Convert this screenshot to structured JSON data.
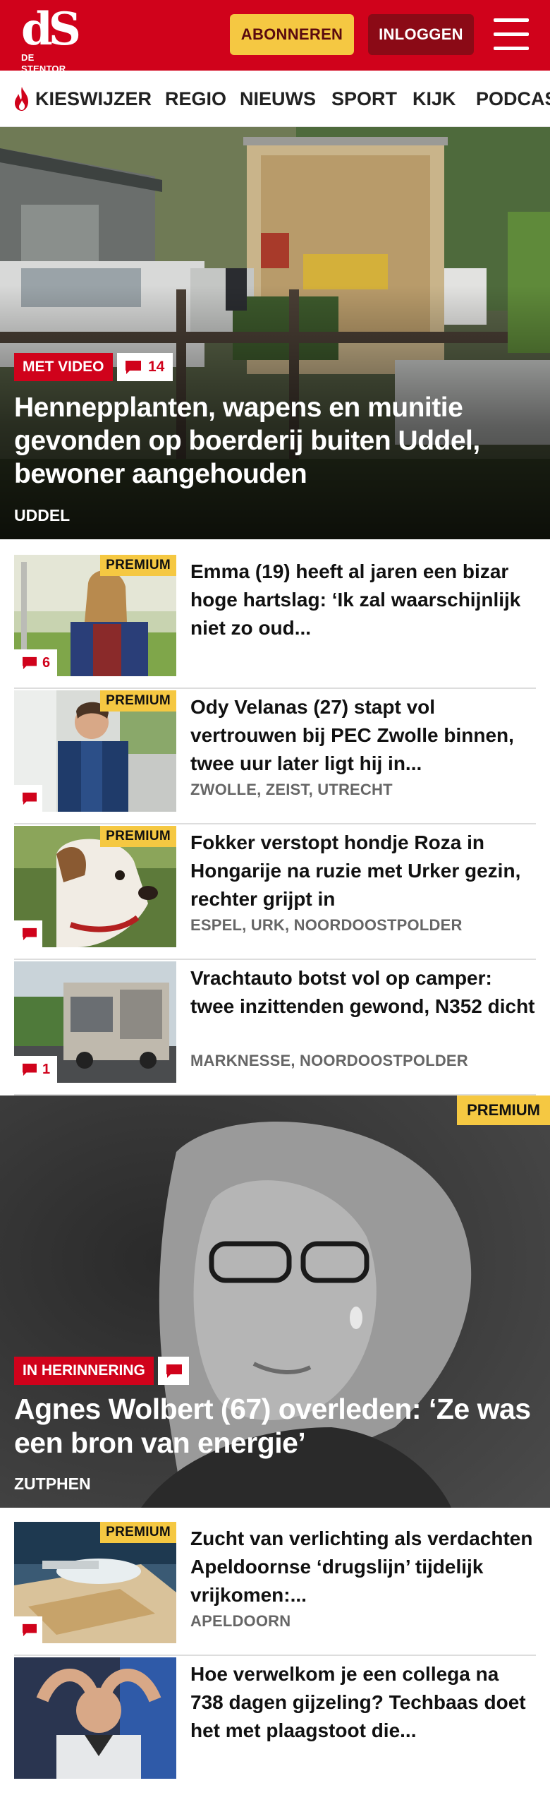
{
  "header": {
    "logo_mark": "dS",
    "logo_name": "DE STENTOR",
    "subscribe_label": "ABONNEREN",
    "login_label": "INLOGGEN",
    "brand_color": "#d0021b",
    "accent_color": "#f5c842"
  },
  "nav": {
    "items": [
      "KIESWIJZER",
      "REGIO",
      "NIEUWS",
      "SPORT",
      "KIJK",
      "PODCASTS"
    ],
    "highlight_icon": "flame-icon"
  },
  "hero": {
    "tag": "MET VIDEO",
    "comments": "14",
    "title": "Hennepplanten, wapens en munitie gevonden op boerderij buiten Uddel, bewoner aangehouden",
    "location": "UDDEL"
  },
  "articles_top": [
    {
      "title": "Emma (19) heeft al jaren een bizar hoge hartslag: ‘Ik zal waarschijnlijk niet zo oud...",
      "location": "",
      "premium": "PREMIUM",
      "comments": "6"
    },
    {
      "title": "Ody Velanas (27) stapt vol vertrouwen bij PEC Zwolle binnen, twee uur later ligt hij in...",
      "location": "ZWOLLE, ZEIST, UTRECHT",
      "premium": "PREMIUM",
      "comments": ""
    },
    {
      "title": "Fokker verstopt hondje Roza in Hongarije na ruzie met Urker gezin, rechter grijpt in",
      "location": "ESPEL, URK, NOORDOOSTPOLDER",
      "premium": "PREMIUM",
      "comments": ""
    },
    {
      "title": "Vrachtauto botst vol op camper: twee inzittenden gewond, N352 dicht",
      "location": "MARKNESSE, NOORDOOSTPOLDER",
      "premium": "",
      "comments": "1"
    }
  ],
  "feature": {
    "premium": "PREMIUM",
    "tag": "IN HERINNERING",
    "title": "Agnes Wolbert (67) overleden: ‘Ze was een bron van energie’",
    "location": "ZUTPHEN"
  },
  "articles_bottom": [
    {
      "title": "Zucht van verlichting als verdachten Apeldoornse ‘drugslijn’ tijdelijk vrijkomen:...",
      "location": "APELDOORN",
      "premium": "PREMIUM",
      "comments": ""
    },
    {
      "title": "Hoe verwelkom je een collega na 738 dagen gijzeling? Techbaas doet het met plaagstoot die...",
      "location": "",
      "premium": "",
      "comments": ""
    }
  ]
}
